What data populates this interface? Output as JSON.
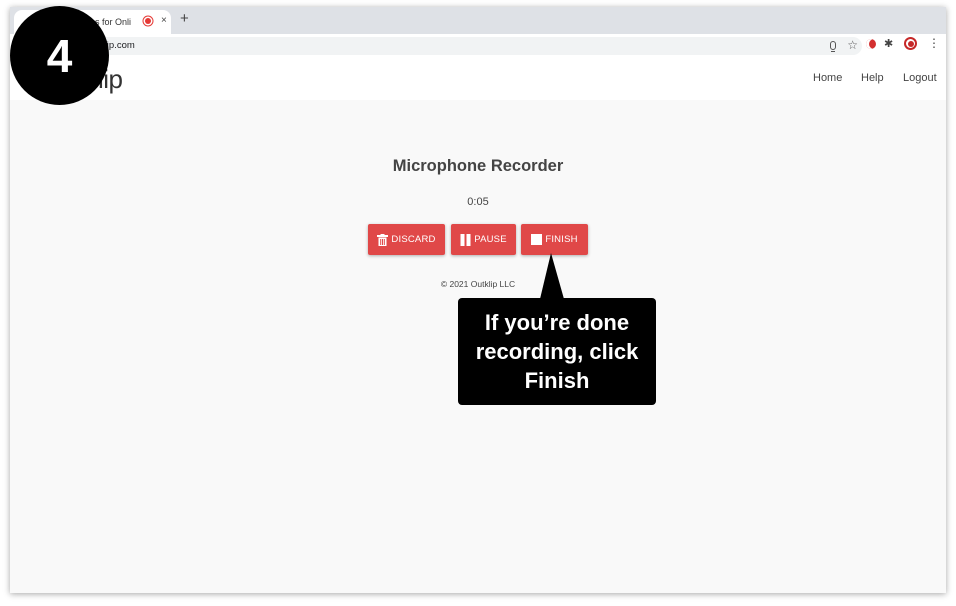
{
  "browser": {
    "tab_title": "os for Onli",
    "tab_close": "×",
    "new_tab": "+",
    "url": "utklip.com"
  },
  "site": {
    "logo": "lip",
    "nav": [
      "Home",
      "Help",
      "Logout"
    ]
  },
  "recorder": {
    "title": "Microphone Recorder",
    "timer": "0:05",
    "buttons": {
      "discard": "DISCARD",
      "pause": "PAUSE",
      "finish": "FINISH"
    },
    "copyright": "© 2021 Outklip LLC"
  },
  "overlay": {
    "step_number": "4",
    "callout_text": "If you’re done recording, click Finish"
  },
  "colors": {
    "button_red": "#e04848",
    "overlay_black": "#000000",
    "page_background": "#f9f9f9"
  },
  "icons": {
    "discard": "trash-icon",
    "pause": "pause-icon",
    "finish": "stop-icon"
  }
}
